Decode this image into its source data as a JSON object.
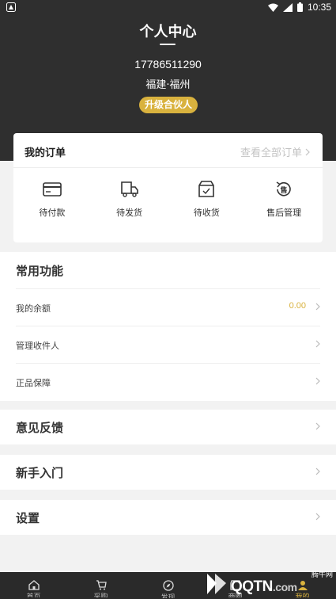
{
  "status_bar": {
    "time": "10:35"
  },
  "header": {
    "title": "个人中心",
    "phone": "17786511290",
    "location": "福建·福州",
    "upgrade_label": "升级合伙人"
  },
  "orders": {
    "title": "我的订单",
    "view_all": "查看全部订单",
    "items": [
      {
        "label": "待付款",
        "icon": "card-icon"
      },
      {
        "label": "待发货",
        "icon": "truck-icon"
      },
      {
        "label": "待收货",
        "icon": "box-icon"
      },
      {
        "label": "售后管理",
        "icon": "after-sales-icon"
      }
    ]
  },
  "common": {
    "title": "常用功能",
    "rows": [
      {
        "label": "我的余额",
        "value": "0.00"
      },
      {
        "label": "管理收件人"
      },
      {
        "label": "正品保障"
      }
    ]
  },
  "feedback_label": "意见反馈",
  "beginner_label": "新手入门",
  "settings_label": "设置",
  "bottom_nav": [
    {
      "label": "首页",
      "icon": "home-icon"
    },
    {
      "label": "采购",
      "icon": "cart-icon"
    },
    {
      "label": "发现",
      "icon": "compass-icon"
    },
    {
      "label": "商圈",
      "icon": "shop-icon"
    },
    {
      "label": "我的",
      "icon": "user-icon"
    }
  ],
  "watermark": {
    "text": "QQTN",
    "suffix": ".com",
    "small": "腾牛网"
  },
  "colors": {
    "header_bg": "#2f2f2f",
    "accent_gold": "#d9b23e",
    "page_bg": "#f2f2f2"
  }
}
